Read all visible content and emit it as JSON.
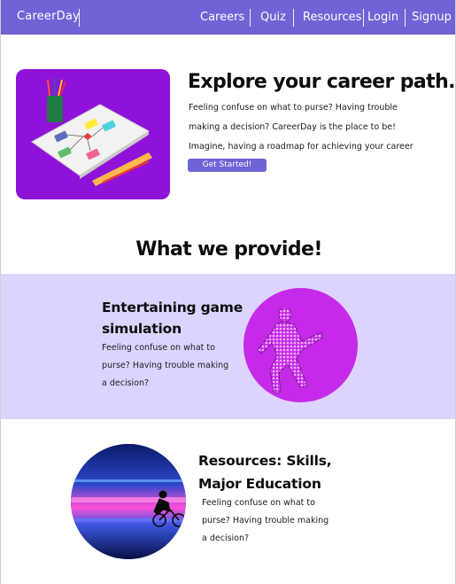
{
  "nav": {
    "brand": "CareerDay",
    "links": [
      "Careers",
      "Quiz",
      "Resources",
      "Login",
      "Signup"
    ]
  },
  "hero": {
    "title": "Explore your career path.",
    "description": "Feeling confuse on what to purse? Having trouble making a decision? CareerDay is the place to be! Imagine,  having a roadmap for achieving your career goals.",
    "cta_label": "Get Started!"
  },
  "provide": {
    "title": "What we provide!"
  },
  "features": [
    {
      "title": "Entertaining game simulation",
      "description": "Feeling confuse on what to purse? Having trouble making a decision?"
    },
    {
      "title": "Resources: Skills, Major Education",
      "description": "Feeling confuse on what to purse? Having trouble making a decision?"
    }
  ],
  "colors": {
    "accent": "#6f63d6",
    "band": "#dcd4ff",
    "hero_image_bg": "#8f12d8",
    "feature_circle": "#c42ae8"
  }
}
